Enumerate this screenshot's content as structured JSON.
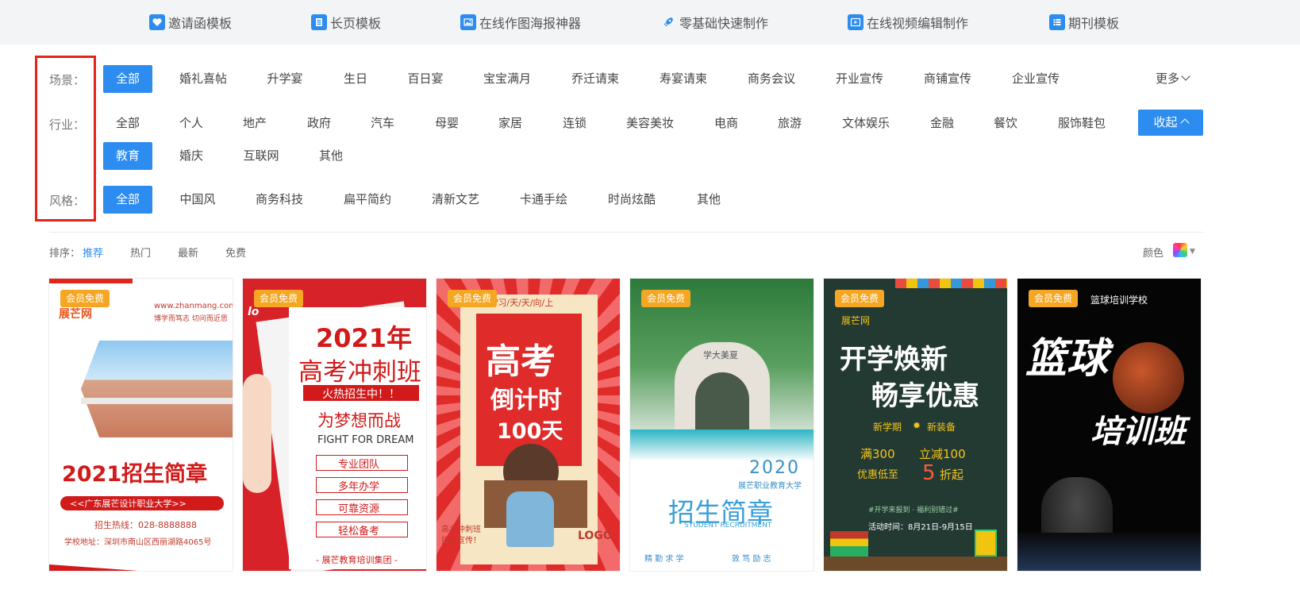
{
  "topnav": [
    {
      "label": "邀请函模板",
      "icon": "invitation-icon"
    },
    {
      "label": "长页模板",
      "icon": "long-page-icon"
    },
    {
      "label": "在线作图海报神器",
      "icon": "image-icon"
    },
    {
      "label": "零基础快速制作",
      "icon": "rocket-icon"
    },
    {
      "label": "在线视频编辑制作",
      "icon": "video-icon"
    },
    {
      "label": "期刊模板",
      "icon": "list-icon"
    }
  ],
  "filters": {
    "scene": {
      "label": "场景：",
      "items": [
        "全部",
        "婚礼喜帖",
        "升学宴",
        "生日",
        "百日宴",
        "宝宝满月",
        "乔迁请柬",
        "寿宴请柬",
        "商务会议",
        "开业宣传",
        "商铺宣传",
        "企业宣传"
      ],
      "active": "全部",
      "more": "更多"
    },
    "industry": {
      "label": "行业：",
      "items": [
        "全部",
        "个人",
        "地产",
        "政府",
        "汽车",
        "母婴",
        "家居",
        "连锁",
        "美容美妆",
        "电商",
        "旅游",
        "文体娱乐",
        "金融",
        "餐饮",
        "服饰鞋包"
      ],
      "items2": [
        "教育",
        "婚庆",
        "互联网",
        "其他"
      ],
      "active": "教育",
      "collapse": "收起"
    },
    "style": {
      "label": "风格：",
      "items": [
        "全部",
        "中国风",
        "商务科技",
        "扁平简约",
        "清新文艺",
        "卡通手绘",
        "时尚炫酷",
        "其他"
      ],
      "active": "全部"
    }
  },
  "sort": {
    "label": "排序：",
    "items": [
      "推荐",
      "热门",
      "最新",
      "免费"
    ],
    "active": "推荐",
    "color_label": "颜色"
  },
  "accent": "#2d8cf0",
  "badge_color": "#f5a623",
  "cards": [
    {
      "badge": "会员免费",
      "logo": "展芒网",
      "url": "www.zhanmang.com",
      "slogan": "博学而笃志 切问而近思",
      "title": "2021招生简章",
      "school": "<<广东展芒设计职业大学>>",
      "hotline": "招生热线：028-8888888",
      "address": "学校地址：深圳市南山区西丽湖路4065号"
    },
    {
      "badge": "会员免费",
      "corner": "lo",
      "year": "2021年",
      "title": "高考冲刺班",
      "banner": "火热招生中！！",
      "motto": "为梦想而战",
      "english": "FIGHT FOR DREAM",
      "features": [
        "专业团队",
        "多年办学",
        "可靠资源",
        "轻松备考"
      ],
      "footer": "- 展芒教育培训集团 -"
    },
    {
      "badge": "会员免费",
      "header": "好/学/习/天/天/向/上",
      "line1": "高考",
      "line2": "倒计时",
      "line3": "100天",
      "side": "高考冲刺班\n招生宣传！",
      "logo": "LOGO"
    },
    {
      "badge": "会员免费",
      "gate": "学大美夏",
      "year": "2020",
      "school": "展芒职业教育大学",
      "title": "招生简章",
      "english": "STUDENT RECRUITMENT",
      "motto": [
        "精 勤 求 学",
        "敦 笃 励 志"
      ]
    },
    {
      "badge": "会员免费",
      "brand": "展芒网",
      "title1": "开学焕新",
      "title2": "畅享优惠",
      "sub": [
        "新学期",
        "新装备"
      ],
      "deal1": "满300",
      "deal2": "立减100",
      "deal3": "优惠低至",
      "deal4": "5",
      "deal5": "折起",
      "tagline": "#开学来报到 · 福利别错过#",
      "dates": "活动时间：8月21日-9月15日"
    },
    {
      "badge": "会员免费",
      "header": "篮球培训学校",
      "title1": "篮球",
      "title2": "培训班"
    }
  ]
}
